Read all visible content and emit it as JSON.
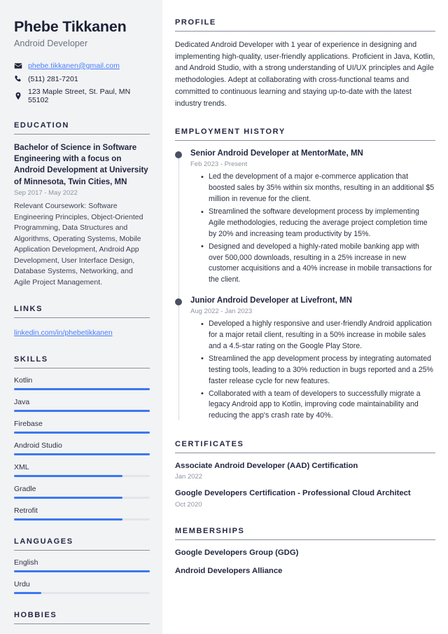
{
  "header": {
    "name": "Phebe Tikkanen",
    "job_title": "Android Developer",
    "contacts": [
      {
        "icon": "envelope-icon",
        "text": "phebe.tikkanen@gmail.com",
        "is_link": true
      },
      {
        "icon": "phone-icon",
        "text": "(511) 281-7201",
        "is_link": false
      },
      {
        "icon": "location-pin-icon",
        "text": "123 Maple Street, St. Paul, MN 55102",
        "is_link": false
      }
    ]
  },
  "sidebar": {
    "education": {
      "heading": "EDUCATION",
      "degree": "Bachelor of Science in Software Engineering with a focus on Android Development at University of Minnesota, Twin Cities, MN",
      "date": "Sep 2017 - May 2022",
      "description": "Relevant Coursework: Software Engineering Principles, Object-Oriented Programming, Data Structures and Algorithms, Operating Systems, Mobile Application Development, Android App Development, User Interface Design, Database Systems, Networking, and Agile Project Management."
    },
    "links": {
      "heading": "LINKS",
      "items": [
        {
          "label": "linkedin.com/in/phebetikkanen"
        }
      ]
    },
    "skills": {
      "heading": "SKILLS",
      "items": [
        {
          "label": "Kotlin",
          "level": 100
        },
        {
          "label": "Java",
          "level": 100
        },
        {
          "label": "Firebase",
          "level": 100
        },
        {
          "label": "Android Studio",
          "level": 100
        },
        {
          "label": "XML",
          "level": 80
        },
        {
          "label": "Gradle",
          "level": 80
        },
        {
          "label": "Retrofit",
          "level": 80
        }
      ]
    },
    "languages": {
      "heading": "LANGUAGES",
      "items": [
        {
          "label": "English",
          "level": 100
        },
        {
          "label": "Urdu",
          "level": 20
        }
      ]
    },
    "hobbies": {
      "heading": "HOBBIES"
    }
  },
  "main": {
    "profile": {
      "heading": "PROFILE",
      "text": "Dedicated Android Developer with 1 year of experience in designing and implementing high-quality, user-friendly applications. Proficient in Java, Kotlin, and Android Studio, with a strong understanding of UI/UX principles and Agile methodologies. Adept at collaborating with cross-functional teams and committed to continuous learning and staying up-to-date with the latest industry trends."
    },
    "employment": {
      "heading": "EMPLOYMENT HISTORY",
      "jobs": [
        {
          "role": "Senior Android Developer at MentorMate, MN",
          "date": "Feb 2023 - Present",
          "points": [
            "Led the development of a major e-commerce application that boosted sales by 35% within six months, resulting in an additional $5 million in revenue for the client.",
            "Streamlined the software development process by implementing Agile methodologies, reducing the average project completion time by 20% and increasing team productivity by 15%.",
            "Designed and developed a highly-rated mobile banking app with over 500,000 downloads, resulting in a 25% increase in new customer acquisitions and a 40% increase in mobile transactions for the client."
          ]
        },
        {
          "role": "Junior Android Developer at Livefront, MN",
          "date": "Aug 2022 - Jan 2023",
          "points": [
            "Developed a highly responsive and user-friendly Android application for a major retail client, resulting in a 50% increase in mobile sales and a 4.5-star rating on the Google Play Store.",
            "Streamlined the app development process by integrating automated testing tools, leading to a 30% reduction in bugs reported and a 25% faster release cycle for new features.",
            "Collaborated with a team of developers to successfully migrate a legacy Android app to Kotlin, improving code maintainability and reducing the app's crash rate by 40%."
          ]
        }
      ]
    },
    "certificates": {
      "heading": "CERTIFICATES",
      "items": [
        {
          "title": "Associate Android Developer (AAD) Certification",
          "date": "Jan 2022"
        },
        {
          "title": "Google Developers Certification - Professional Cloud Architect",
          "date": "Oct 2020"
        }
      ]
    },
    "memberships": {
      "heading": "MEMBERSHIPS",
      "items": [
        {
          "title": "Google Developers Group (GDG)",
          "date": ""
        },
        {
          "title": "Android Developers Alliance",
          "date": ""
        }
      ]
    }
  },
  "colors": {
    "sidebar_bg": "#f1f3f5",
    "heading": "#232741",
    "accent_blue": "#3b78f0",
    "link_blue": "#4a7dfc",
    "muted": "#9095a1",
    "track": "#e2e5ea"
  }
}
